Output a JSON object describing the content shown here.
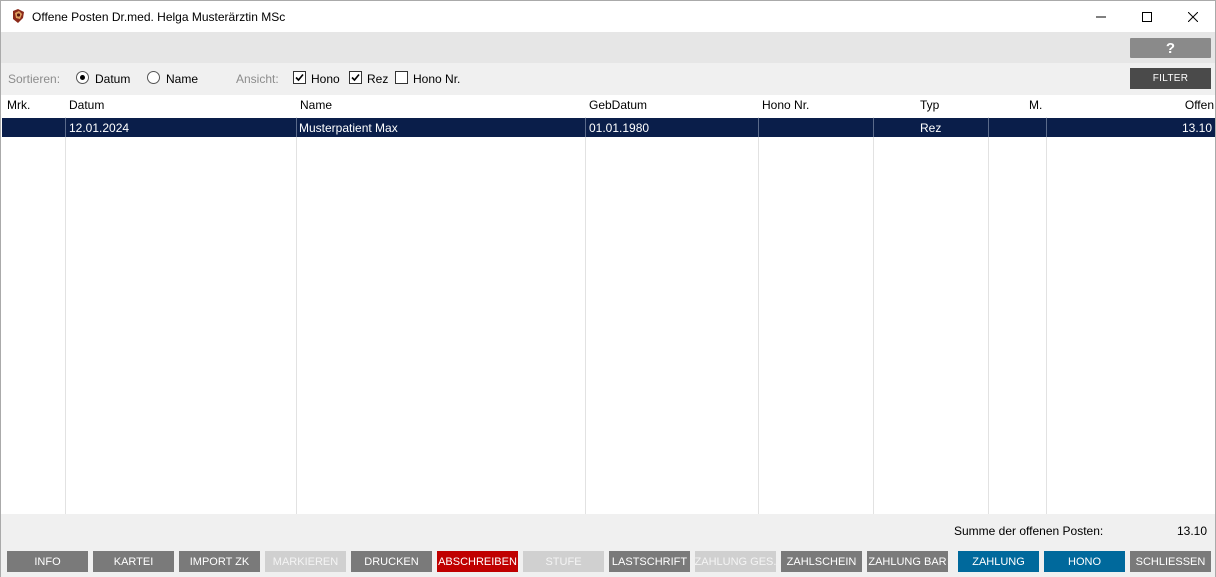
{
  "window": {
    "title": "Offene Posten Dr.med. Helga Musterärztin MSc"
  },
  "helpbar": {
    "help_label": "?"
  },
  "options": {
    "sort_label": "Sortieren:",
    "sort_options": [
      {
        "label": "Datum",
        "selected": true
      },
      {
        "label": "Name",
        "selected": false
      }
    ],
    "view_label": "Ansicht:",
    "view_options": [
      {
        "label": "Hono",
        "checked": true
      },
      {
        "label": "Rez",
        "checked": true
      },
      {
        "label": "Hono Nr.",
        "checked": false
      }
    ],
    "filter_label": "FILTER"
  },
  "table": {
    "columns": [
      "Mrk.",
      "Datum",
      "Name",
      "GebDatum",
      "Hono Nr.",
      "Typ",
      "M.",
      "Offen"
    ],
    "rows": [
      {
        "mrk": "",
        "datum": "12.01.2024",
        "name": "Musterpatient Max",
        "gebdatum": "01.01.1980",
        "hono_nr": "",
        "typ": "Rez",
        "m": "",
        "offen": "13.10",
        "selected": true
      }
    ]
  },
  "summary": {
    "label": "Summe der offenen Posten:",
    "value": "13.10"
  },
  "buttons": [
    {
      "label": "INFO",
      "state": "gray"
    },
    {
      "label": "KARTEI",
      "state": "gray"
    },
    {
      "label": "IMPORT ZK",
      "state": "gray"
    },
    {
      "label": "MARKIEREN",
      "state": "disabled"
    },
    {
      "label": "DRUCKEN",
      "state": "gray"
    },
    {
      "label": "ABSCHREIBEN",
      "state": "red"
    },
    {
      "label": "STUFE",
      "state": "disabled"
    },
    {
      "label": "LASTSCHRIFT",
      "state": "gray"
    },
    {
      "label": "ZAHLUNG GES.",
      "state": "disabled"
    },
    {
      "label": "ZAHLSCHEIN",
      "state": "gray"
    },
    {
      "label": "ZAHLUNG BAR",
      "state": "gray"
    },
    {
      "label": "ZAHLUNG",
      "state": "blue"
    },
    {
      "label": "HONO",
      "state": "blue"
    },
    {
      "label": "SCHLIESSEN",
      "state": "gray"
    }
  ],
  "colors": {
    "selection": "#0a1e4a",
    "accent_blue": "#00699c",
    "danger_red": "#c00000",
    "button_gray": "#7a7a7a"
  }
}
